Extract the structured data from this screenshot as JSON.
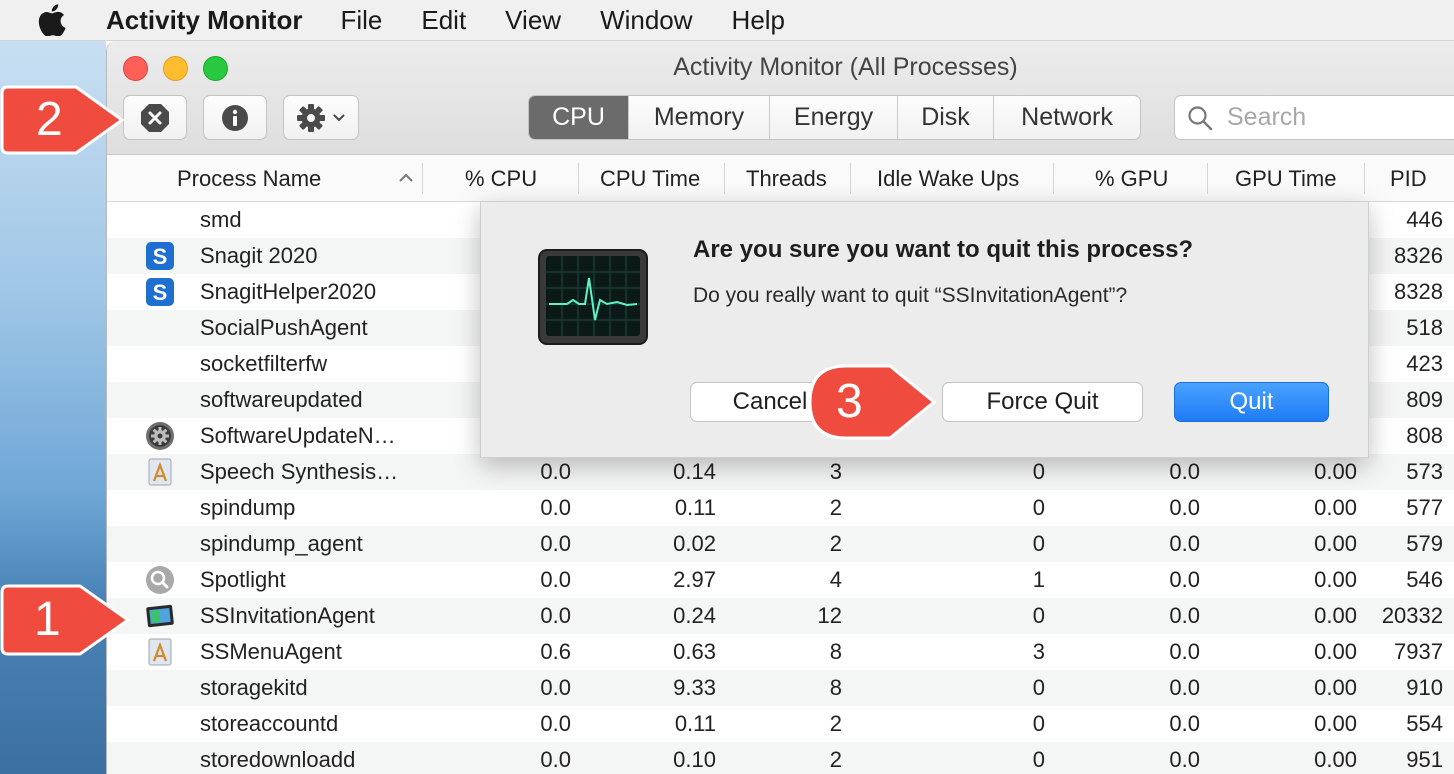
{
  "menubar": {
    "app_name": "Activity Monitor",
    "items": [
      "File",
      "Edit",
      "View",
      "Window",
      "Help"
    ]
  },
  "window": {
    "title": "Activity Monitor (All Processes)",
    "tabs": [
      {
        "label": "CPU",
        "active": true
      },
      {
        "label": "Memory",
        "active": false
      },
      {
        "label": "Energy",
        "active": false
      },
      {
        "label": "Disk",
        "active": false
      },
      {
        "label": "Network",
        "active": false
      }
    ],
    "search_placeholder": "Search"
  },
  "columns": [
    "Process Name",
    "% CPU",
    "CPU Time",
    "Threads",
    "Idle Wake Ups",
    "% GPU",
    "GPU Time",
    "PID"
  ],
  "rows": [
    {
      "name": "smd",
      "icon": "none",
      "cpu": "",
      "cpu_time": "",
      "threads": "",
      "idle": "",
      "gpu": "",
      "gpu_time": "",
      "pid": "446"
    },
    {
      "name": "Snagit 2020",
      "icon": "snagit-icon",
      "cpu": "",
      "cpu_time": "",
      "threads": "",
      "idle": "",
      "gpu": "",
      "gpu_time": "",
      "pid": "8326"
    },
    {
      "name": "SnagitHelper2020",
      "icon": "snagit-icon",
      "cpu": "",
      "cpu_time": "",
      "threads": "",
      "idle": "",
      "gpu": "",
      "gpu_time": "",
      "pid": "8328"
    },
    {
      "name": "SocialPushAgent",
      "icon": "none",
      "cpu": "",
      "cpu_time": "",
      "threads": "",
      "idle": "",
      "gpu": "",
      "gpu_time": "",
      "pid": "518"
    },
    {
      "name": "socketfilterfw",
      "icon": "none",
      "cpu": "",
      "cpu_time": "",
      "threads": "",
      "idle": "",
      "gpu": "",
      "gpu_time": "",
      "pid": "423"
    },
    {
      "name": "softwareupdated",
      "icon": "none",
      "cpu": "",
      "cpu_time": "",
      "threads": "",
      "idle": "",
      "gpu": "",
      "gpu_time": "",
      "pid": "809"
    },
    {
      "name": "SoftwareUpdateN…",
      "icon": "gear-icon",
      "cpu": "",
      "cpu_time": "",
      "threads": "",
      "idle": "",
      "gpu": "",
      "gpu_time": "",
      "pid": "808"
    },
    {
      "name": "Speech Synthesis…",
      "icon": "app-generic-icon",
      "cpu": "0.0",
      "cpu_time": "0.14",
      "threads": "3",
      "idle": "0",
      "gpu": "0.0",
      "gpu_time": "0.00",
      "pid": "573"
    },
    {
      "name": "spindump",
      "icon": "none",
      "cpu": "0.0",
      "cpu_time": "0.11",
      "threads": "2",
      "idle": "0",
      "gpu": "0.0",
      "gpu_time": "0.00",
      "pid": "577"
    },
    {
      "name": "spindump_agent",
      "icon": "none",
      "cpu": "0.0",
      "cpu_time": "0.02",
      "threads": "2",
      "idle": "0",
      "gpu": "0.0",
      "gpu_time": "0.00",
      "pid": "579"
    },
    {
      "name": "Spotlight",
      "icon": "spotlight-icon",
      "cpu": "0.0",
      "cpu_time": "2.97",
      "threads": "4",
      "idle": "1",
      "gpu": "0.0",
      "gpu_time": "0.00",
      "pid": "546"
    },
    {
      "name": "SSInvitationAgent",
      "icon": "screen-sharing-icon",
      "cpu": "0.0",
      "cpu_time": "0.24",
      "threads": "12",
      "idle": "0",
      "gpu": "0.0",
      "gpu_time": "0.00",
      "pid": "20332"
    },
    {
      "name": "SSMenuAgent",
      "icon": "app-generic-icon",
      "cpu": "0.6",
      "cpu_time": "0.63",
      "threads": "8",
      "idle": "3",
      "gpu": "0.0",
      "gpu_time": "0.00",
      "pid": "7937"
    },
    {
      "name": "storagekitd",
      "icon": "none",
      "cpu": "0.0",
      "cpu_time": "9.33",
      "threads": "8",
      "idle": "0",
      "gpu": "0.0",
      "gpu_time": "0.00",
      "pid": "910"
    },
    {
      "name": "storeaccountd",
      "icon": "none",
      "cpu": "0.0",
      "cpu_time": "0.11",
      "threads": "2",
      "idle": "0",
      "gpu": "0.0",
      "gpu_time": "0.00",
      "pid": "554"
    },
    {
      "name": "storedownloadd",
      "icon": "none",
      "cpu": "0.0",
      "cpu_time": "0.10",
      "threads": "2",
      "idle": "0",
      "gpu": "0.0",
      "gpu_time": "0.00",
      "pid": "951"
    }
  ],
  "dialog": {
    "title": "Are you sure you want to quit this process?",
    "message": "Do you really want to quit “SSInvitationAgent”?",
    "cancel_label": "Cancel",
    "force_quit_label": "Force Quit",
    "quit_label": "Quit"
  },
  "callouts": {
    "one": "1",
    "two": "2",
    "three": "3"
  },
  "colors": {
    "callout": "#ef4b3f",
    "accent": "#1f7cf5",
    "active_tab": "#6b6b6b"
  }
}
